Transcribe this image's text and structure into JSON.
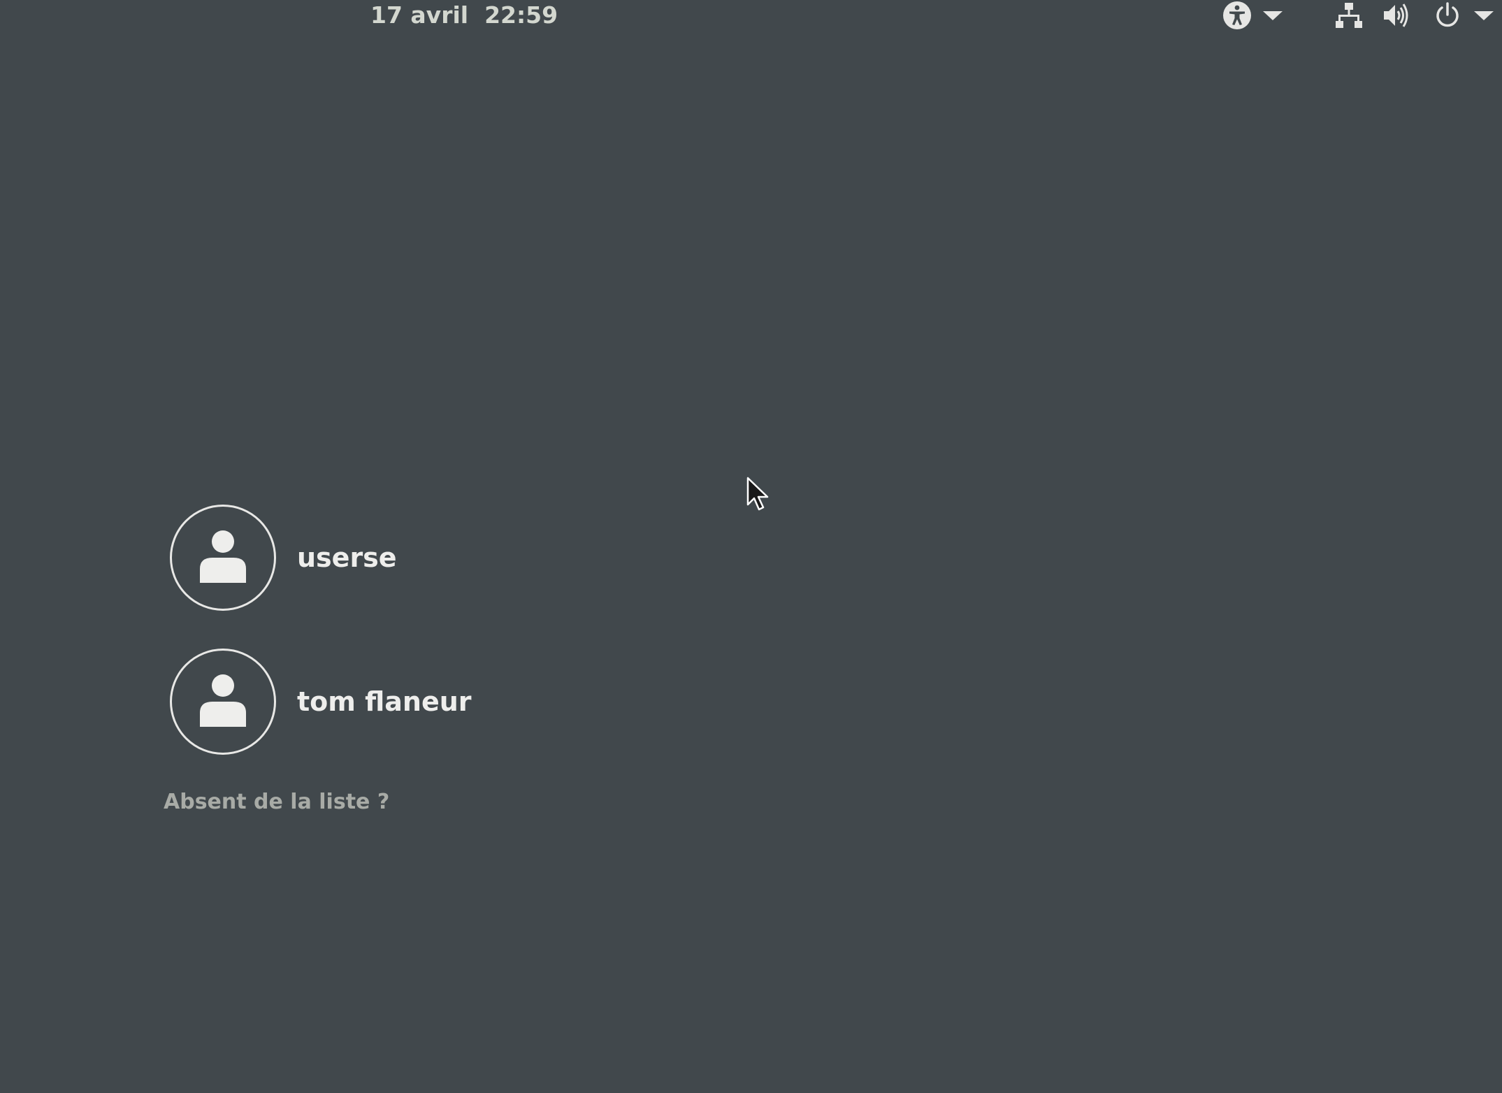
{
  "topbar": {
    "clock": "17 avril  22:59",
    "icons": {
      "accessibility": "accessibility-icon",
      "accessibility_menu": "chevron-down-icon",
      "network": "network-wired-icon",
      "volume": "volume-high-icon",
      "power": "power-icon",
      "power_menu": "chevron-down-icon"
    }
  },
  "users": [
    {
      "name": "userse",
      "avatar": "user-avatar-icon"
    },
    {
      "name": "tom flaneur",
      "avatar": "user-avatar-icon"
    }
  ],
  "not_listed_label": "Absent de la liste ?",
  "colors": {
    "background": "#41484c",
    "text": "#eeeeec",
    "muted_text": "#a8aba6",
    "clock_text": "#d3d7cf"
  }
}
